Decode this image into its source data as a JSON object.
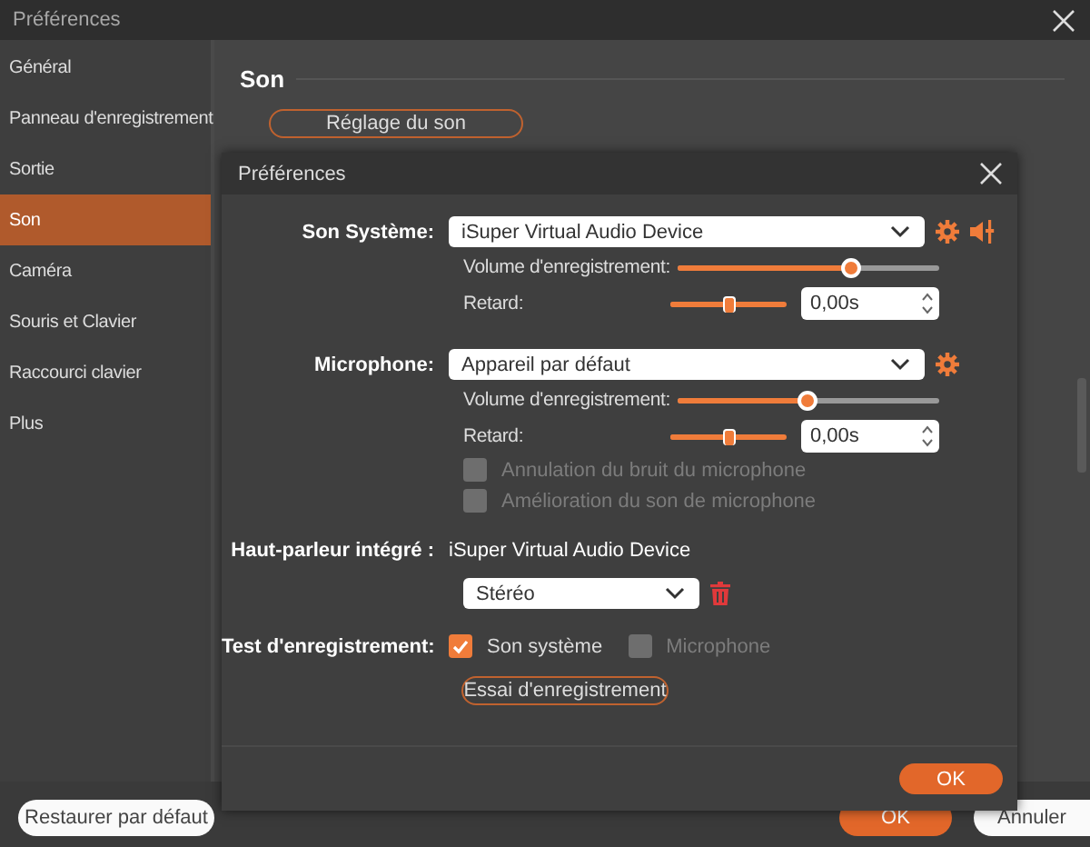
{
  "window": {
    "title": "Préférences"
  },
  "sidebar": {
    "items": [
      {
        "label": "Général",
        "selected": false
      },
      {
        "label": "Panneau d'enregistrement",
        "selected": false
      },
      {
        "label": "Sortie",
        "selected": false
      },
      {
        "label": "Son",
        "selected": true
      },
      {
        "label": "Caméra",
        "selected": false
      },
      {
        "label": "Souris et Clavier",
        "selected": false
      },
      {
        "label": "Raccourci clavier",
        "selected": false
      },
      {
        "label": "Plus",
        "selected": false
      }
    ]
  },
  "section": {
    "title": "Son",
    "button": "Réglage du son"
  },
  "footer": {
    "restore": "Restaurer par défaut",
    "ok": "OK",
    "cancel": "Annuler"
  },
  "dialog": {
    "title": "Préférences",
    "system_sound": {
      "label": "Son Système:",
      "device": "iSuper Virtual Audio Device",
      "volume_label": "Volume d'enregistrement:",
      "volume": {
        "level": 0.66
      },
      "delay_label": "Retard:",
      "delay": {
        "level": 0.5
      },
      "delay_value": "0,00s"
    },
    "microphone": {
      "label": "Microphone:",
      "device": "Appareil par défaut",
      "volume_label": "Volume d'enregistrement:",
      "volume": {
        "level": 0.5
      },
      "delay_label": "Retard:",
      "delay": {
        "level": 0.5
      },
      "delay_value": "0,00s",
      "options": [
        {
          "label": "Annulation du bruit du microphone",
          "checked": false,
          "disabled": true
        },
        {
          "label": "Amélioration du son de microphone",
          "checked": false,
          "disabled": true
        }
      ]
    },
    "speaker": {
      "label": "Haut-parleur intégré :",
      "device": "iSuper Virtual Audio Device",
      "mode": "Stéréo"
    },
    "test": {
      "label": "Test d'enregistrement:",
      "options": [
        {
          "label": "Son système",
          "checked": true,
          "disabled": false
        },
        {
          "label": "Microphone",
          "checked": false,
          "disabled": true
        }
      ],
      "button": "Essai d'enregistrement"
    },
    "ok": "OK"
  }
}
